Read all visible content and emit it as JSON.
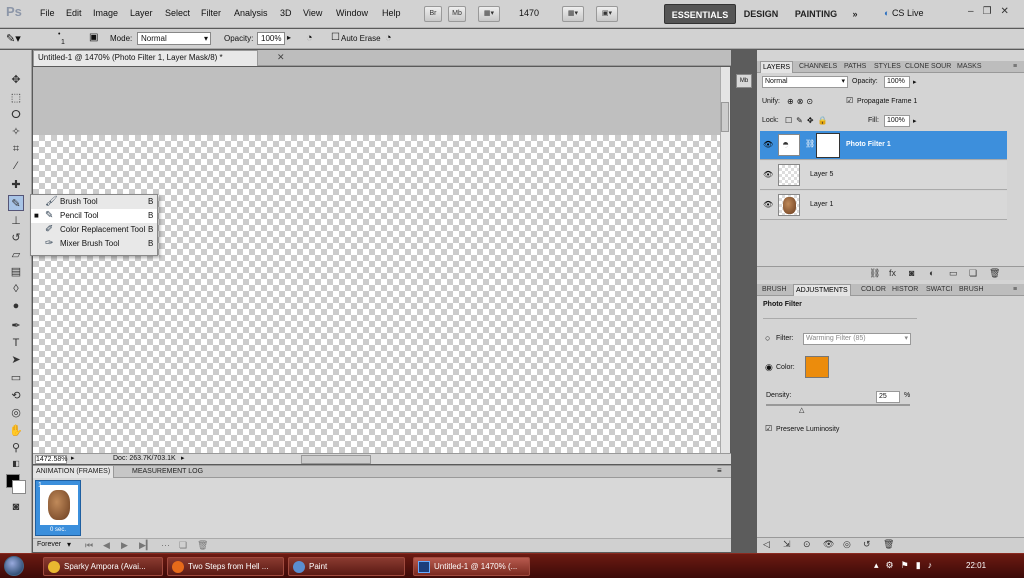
{
  "menubar": {
    "logo": "Ps",
    "items": [
      "File",
      "Edit",
      "Image",
      "Layer",
      "Select",
      "Filter",
      "Analysis",
      "3D",
      "View",
      "Window",
      "Help"
    ],
    "bridge_button": "Br",
    "minibridge_button": "Mb",
    "zoom": "1470",
    "workspaces": [
      "ESSENTIALS",
      "DESIGN",
      "PAINTING"
    ],
    "more": "»",
    "cs_live": "CS Live"
  },
  "options_bar": {
    "brush_size": "1",
    "mode_label": "Mode:",
    "mode_value": "Normal",
    "opacity_label": "Opacity:",
    "opacity_value": "100%",
    "auto_erase_label": "Auto Erase"
  },
  "document": {
    "tab_title": "Untitled-1 @ 1470% (Photo Filter 1, Layer Mask/8) *",
    "zoom_field": "1472.58%",
    "doc_info": "Doc: 263.7K/703.1K"
  },
  "flyout": {
    "items": [
      {
        "label": "Brush Tool",
        "key": "B",
        "selected": false
      },
      {
        "label": "Pencil Tool",
        "key": "B",
        "selected": true
      },
      {
        "label": "Color Replacement Tool",
        "key": "B",
        "selected": false
      },
      {
        "label": "Mixer Brush Tool",
        "key": "B",
        "selected": false
      }
    ]
  },
  "animation": {
    "tabs": [
      "ANIMATION (FRAMES)",
      "MEASUREMENT LOG"
    ],
    "frame_number": "1",
    "frame_delay": "0 sec.",
    "loop": "Forever"
  },
  "layers_panel": {
    "tabs": [
      "LAYERS",
      "CHANNELS",
      "PATHS",
      "STYLES",
      "CLONE SOUR",
      "MASKS"
    ],
    "blend_mode": "Normal",
    "opacity_label": "Opacity:",
    "opacity_value": "100%",
    "unify_label": "Unify:",
    "propagate_label": "Propagate Frame 1",
    "lock_label": "Lock:",
    "fill_label": "Fill:",
    "fill_value": "100%",
    "layers": [
      {
        "name": "Photo Filter 1",
        "selected": true
      },
      {
        "name": "Layer 5",
        "selected": false
      },
      {
        "name": "Layer 1",
        "selected": false
      }
    ]
  },
  "adjustments_panel": {
    "tabs": [
      "BRUSH",
      "ADJUSTMENTS",
      "COLOR",
      "HISTOR",
      "SWATCI",
      "BRUSH"
    ],
    "title": "Photo Filter",
    "filter_label": "Filter:",
    "filter_value": "Warming Filter (85)",
    "color_label": "Color:",
    "color_value": "#ec8c0c",
    "density_label": "Density:",
    "density_value": "25",
    "density_unit": "%",
    "density_fraction": 0.25,
    "preserve_label": "Preserve Luminosity"
  },
  "taskbar": {
    "tasks": [
      "Sparky Ampora (Avai...",
      "Two Steps from Hell ...",
      "Paint",
      "Untitled-1 @ 1470% (..."
    ],
    "clock": "22:01"
  }
}
